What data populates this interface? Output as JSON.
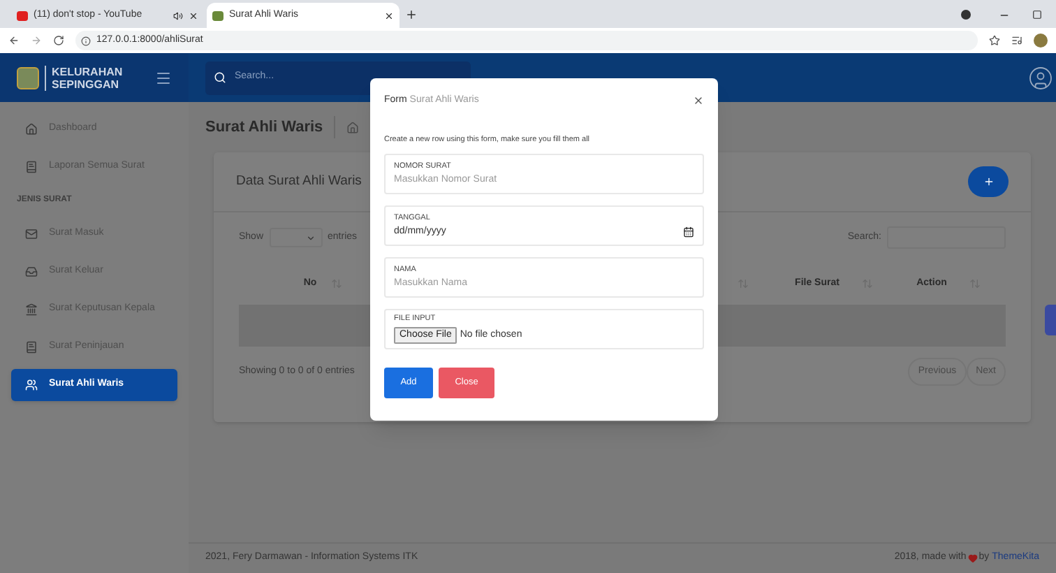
{
  "browser": {
    "tabs": [
      {
        "title": "(11) don't stop - YouTube",
        "selected": false,
        "audio": true
      },
      {
        "title": "Surat Ahli Waris",
        "selected": true,
        "audio": false
      }
    ],
    "url": "127.0.0.1:8000/ahliSurat"
  },
  "header": {
    "brand": [
      "KELURAHAN",
      "SEPINGGAN"
    ],
    "search_placeholder": "Search..."
  },
  "sidebar": {
    "items": [
      {
        "label": "Dashboard",
        "kind": "home",
        "selected": false
      },
      {
        "label": "Laporan Semua Surat",
        "kind": "book",
        "selected": false
      },
      {
        "label": "JENIS SURAT",
        "kind": "heading"
      },
      {
        "label": "Surat Masuk",
        "kind": "mail",
        "selected": false
      },
      {
        "label": "Surat Keluar",
        "kind": "outbox",
        "selected": false
      },
      {
        "label": "Surat Keputusan Kepala",
        "kind": "bank",
        "selected": false
      },
      {
        "label": "Surat Peninjauan",
        "kind": "book",
        "selected": false
      },
      {
        "label": "Surat Ahli Waris",
        "kind": "users",
        "selected": true
      }
    ]
  },
  "page": {
    "title": "Surat Ahli Waris",
    "card_title": "Data Surat Ahli Waris",
    "show": "Show",
    "entries": "entries",
    "search_label": "Search:",
    "columns": [
      {
        "label": "No"
      },
      {
        "label": "File Surat"
      },
      {
        "label": "Action"
      }
    ],
    "info": "Showing 0 to 0 of 0 entries",
    "pager": [
      "Previous",
      "Next"
    ]
  },
  "footer": {
    "left": "2021, Fery Darmawan - Information Systems ITK",
    "right": "2018, made with",
    "by": "by",
    "link": "ThemeKita"
  },
  "modal": {
    "title_lead": "Form",
    "title": "Surat Ahli Waris",
    "subtitle": "Create a new row using this form, make sure you fill them all",
    "fields": [
      {
        "label": "NOMOR SURAT",
        "kind": "text",
        "placeholder": "Masukkan Nomor Surat"
      },
      {
        "label": "TANGGAL",
        "kind": "date",
        "value": "dd/mm/yyyy"
      },
      {
        "label": "NAMA",
        "kind": "text",
        "placeholder": "Masukkan Nama"
      },
      {
        "label": "FILE INPUT",
        "kind": "file",
        "button": "Choose File",
        "value": "No file chosen"
      }
    ],
    "buttons": [
      {
        "label": "Add",
        "kind": "primary"
      },
      {
        "label": "Close",
        "kind": "danger"
      }
    ]
  }
}
